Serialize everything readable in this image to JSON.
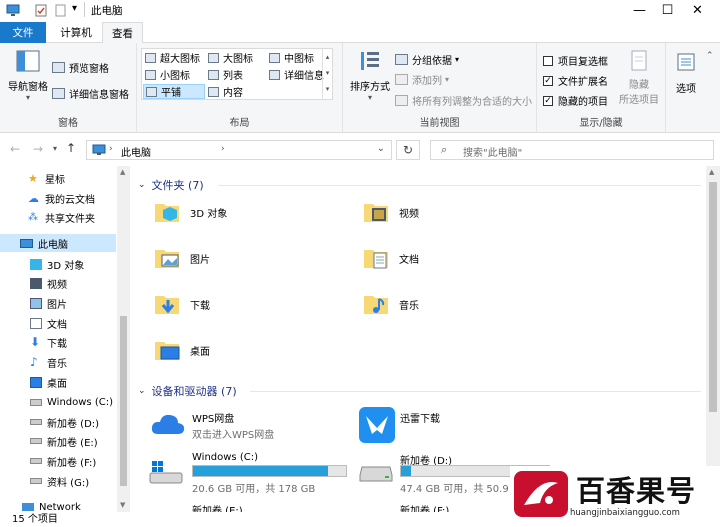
{
  "window": {
    "title": "此电脑",
    "controls": [
      "—",
      "☐",
      "✕"
    ]
  },
  "ribbon_tabs": [
    {
      "label": "文件"
    },
    {
      "label": "计算机"
    },
    {
      "label": "查看"
    }
  ],
  "ribbon": {
    "panes": {
      "label": "窗格",
      "nav_pane": "导航窗格",
      "preview_pane": "预览窗格",
      "details_pane": "详细信息窗格"
    },
    "layout": {
      "label": "布局",
      "options": [
        "超大图标",
        "大图标",
        "中图标",
        "小图标",
        "列表",
        "详细信息",
        "平铺",
        "内容"
      ]
    },
    "current_view": {
      "label": "当前视图",
      "sort": "排序方式",
      "group_by": "分组依据",
      "add_column": "添加列",
      "size_all": "将所有列调整为合适的大小"
    },
    "show_hide": {
      "label": "显示/隐藏",
      "item_checkbox": "项目复选框",
      "file_ext": "文件扩展名",
      "hidden_items": "隐藏的项目",
      "item_checkbox_checked": false,
      "file_ext_checked": true,
      "hidden_items_checked": true,
      "hide": "隐藏",
      "selected_items": "所选项目"
    },
    "options": "选项"
  },
  "address": {
    "path": "此电脑",
    "search_placeholder": "搜索\"此电脑\""
  },
  "nav": [
    {
      "label": "星标"
    },
    {
      "label": "我的云文档"
    },
    {
      "label": "共享文件夹"
    },
    {
      "label": "此电脑"
    },
    {
      "label": "3D 对象"
    },
    {
      "label": "视频"
    },
    {
      "label": "图片"
    },
    {
      "label": "文档"
    },
    {
      "label": "下载"
    },
    {
      "label": "音乐"
    },
    {
      "label": "桌面"
    },
    {
      "label": "Windows (C:)"
    },
    {
      "label": "新加卷 (D:)"
    },
    {
      "label": "新加卷 (E:)"
    },
    {
      "label": "新加卷 (F:)"
    },
    {
      "label": "资料 (G:)"
    },
    {
      "label": "Network"
    }
  ],
  "sections": {
    "folders_header": "文件夹 (7)",
    "devices_header": "设备和驱动器 (7)"
  },
  "folders": [
    {
      "label": "3D 对象"
    },
    {
      "label": "视频"
    },
    {
      "label": "图片"
    },
    {
      "label": "文档"
    },
    {
      "label": "下载"
    },
    {
      "label": "音乐"
    },
    {
      "label": "桌面"
    }
  ],
  "devices": {
    "wps": {
      "name": "WPS网盘",
      "desc": "双击进入WPS网盘"
    },
    "xunlei": {
      "name": "迅雷下载"
    },
    "c": {
      "name": "Windows (C:)",
      "info": "20.6 GB 可用，共 178 GB",
      "used_fraction": 0.88
    },
    "d": {
      "name": "新加卷 (D:)",
      "info": "47.4 GB 可用，共 50.9 G",
      "used_fraction": 0.07
    },
    "e_partial": "新加卷 (E:)",
    "f_partial": "新加卷 (F:)"
  },
  "status": {
    "count": "15 个项目"
  },
  "watermark": {
    "logo_text": "百香果号",
    "url": "huangjinbaixiangguo.com"
  },
  "colors": {
    "accent": "#1979ca",
    "header": "#1e3287",
    "bar": "#26a0da"
  }
}
